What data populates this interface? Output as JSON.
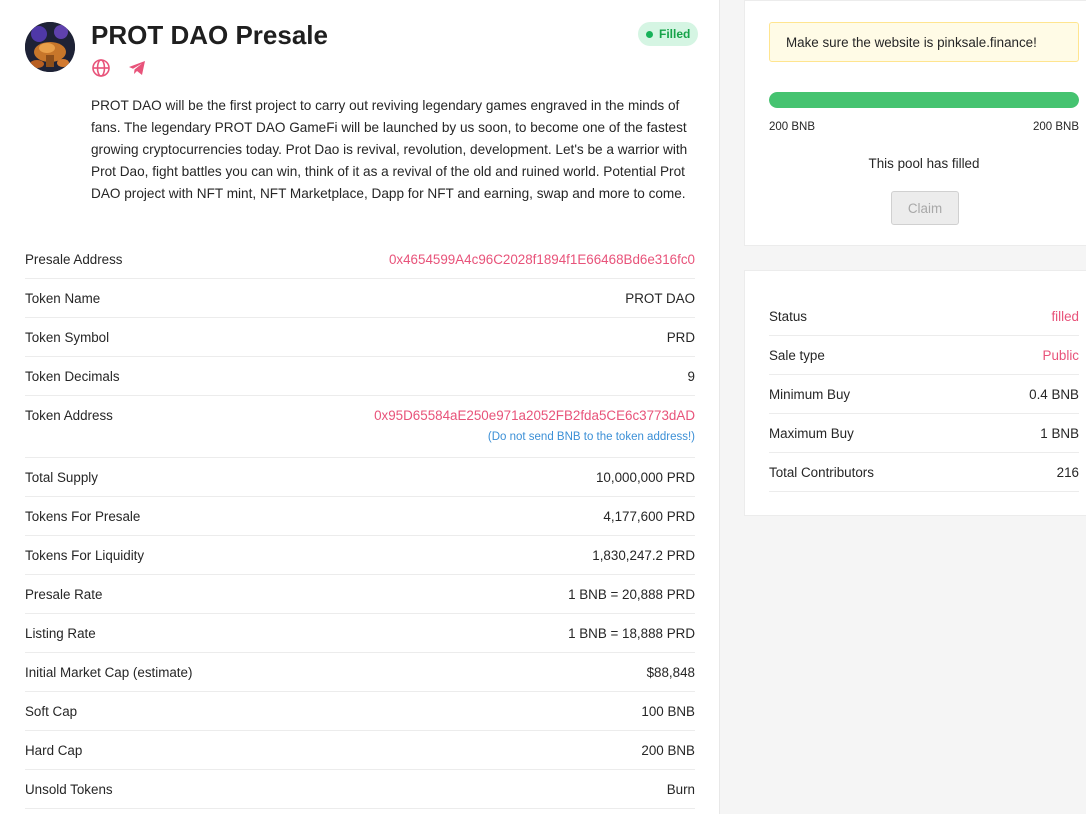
{
  "header": {
    "title": "PROT DAO Presale",
    "status_badge": "Filled",
    "icons": [
      "globe-icon",
      "telegram-icon"
    ]
  },
  "description": "PROT DAO will be the first project to carry out reviving legendary games engraved in the minds of fans. The legendary PROT DAO GameFi will be launched by us soon, to become one of the fastest growing cryptocurrencies today. Prot Dao is revival, revolution, development. Let's be a warrior with Prot Dao, fight battles you can win, think of it as a revival of the old and ruined world. Potential Prot DAO project with NFT mint, NFT Marketplace, Dapp for NFT and earning, swap and more to come.",
  "details": [
    {
      "label": "Presale Address",
      "value": "0x4654599A4c96C2028f1894f1E66468Bd6e316fc0"
    },
    {
      "label": "Token Name",
      "value": "PROT DAO"
    },
    {
      "label": "Token Symbol",
      "value": "PRD"
    },
    {
      "label": "Token Decimals",
      "value": "9"
    },
    {
      "label": "Token Address",
      "value": "0x95D65584aE250e971a2052FB2fda5CE6c3773dAD",
      "note": "(Do not send BNB to the token address!)"
    },
    {
      "label": "Total Supply",
      "value": "10,000,000 PRD"
    },
    {
      "label": "Tokens For Presale",
      "value": "4,177,600 PRD"
    },
    {
      "label": "Tokens For Liquidity",
      "value": "1,830,247.2 PRD"
    },
    {
      "label": "Presale Rate",
      "value": "1 BNB = 20,888 PRD"
    },
    {
      "label": "Listing Rate",
      "value": "1 BNB = 18,888 PRD"
    },
    {
      "label": "Initial Market Cap (estimate)",
      "value": "$88,848"
    },
    {
      "label": "Soft Cap",
      "value": "100 BNB"
    },
    {
      "label": "Hard Cap",
      "value": "200 BNB"
    },
    {
      "label": "Unsold Tokens",
      "value": "Burn"
    }
  ],
  "pool": {
    "alert": "Make sure the website is pinksale.finance!",
    "progress_percent": 100,
    "progress_left": "200 BNB",
    "progress_right": "200 BNB",
    "message": "This pool has filled",
    "claim_label": "Claim"
  },
  "sale_info": [
    {
      "label": "Status",
      "value": "filled"
    },
    {
      "label": "Sale type",
      "value": "Public"
    },
    {
      "label": "Minimum Buy",
      "value": "0.4 BNB"
    },
    {
      "label": "Maximum Buy",
      "value": "1 BNB"
    },
    {
      "label": "Total Contributors",
      "value": "216"
    }
  ],
  "colors": {
    "accent_pink": "#e8537a",
    "progress_green": "#45c370",
    "note_blue": "#3b8fd6",
    "badge_bg": "#d5f5e3"
  }
}
